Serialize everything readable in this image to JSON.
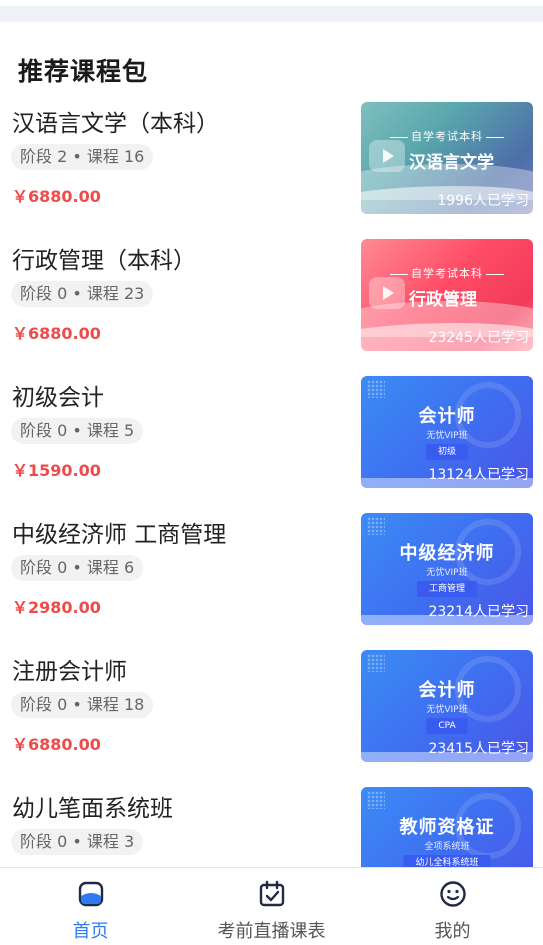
{
  "section_title": "推荐课程包",
  "courses": [
    {
      "title": "汉语言文学（本科）",
      "meta": "阶段 2 • 课程 16",
      "price": "￥6880.00",
      "style": "teal",
      "thumb": {
        "sub": "自学考试本科",
        "main": "汉语言文学",
        "learners": "1996人已学习"
      }
    },
    {
      "title": "行政管理（本科）",
      "meta": "阶段 0 • 课程 23",
      "price": "￥6880.00",
      "style": "red",
      "thumb": {
        "sub": "自学考试本科",
        "main": "行政管理",
        "learners": "23245人已学习"
      }
    },
    {
      "title": "初级会计",
      "meta": "阶段 0 • 课程 5",
      "price": "￥1590.00",
      "style": "blue",
      "thumb": {
        "main": "会计师",
        "vip": "无忧VIP班",
        "tag": "初级",
        "learners": "13124人已学习"
      }
    },
    {
      "title": "中级经济师 工商管理",
      "meta": "阶段 0 • 课程 6",
      "price": "￥2980.00",
      "style": "blue",
      "thumb": {
        "main": "中级经济师",
        "vip": "无忧VIP班",
        "tag": "工商管理",
        "learners": "23214人已学习"
      }
    },
    {
      "title": "注册会计师",
      "meta": "阶段 0 • 课程 18",
      "price": "￥6880.00",
      "style": "blue",
      "thumb": {
        "main": "会计师",
        "vip": "无忧VIP班",
        "tag": "CPA",
        "learners": "23415人已学习"
      }
    },
    {
      "title": "幼儿笔面系统班",
      "meta": "阶段 0 • 课程 3",
      "price": "",
      "style": "blue",
      "thumb": {
        "main": "教师资格证",
        "vip": "全项系统班",
        "tag": "幼儿全科系统班",
        "learners": ""
      }
    }
  ],
  "tabbar": {
    "home": {
      "label": "首页",
      "icon": "home-icon"
    },
    "schedule": {
      "label": "考前直播课表",
      "icon": "calendar-check-icon"
    },
    "mine": {
      "label": "我的",
      "icon": "smiley-icon"
    }
  },
  "colors": {
    "accent": "#2f7bf3",
    "price": "#ef4b4b"
  }
}
